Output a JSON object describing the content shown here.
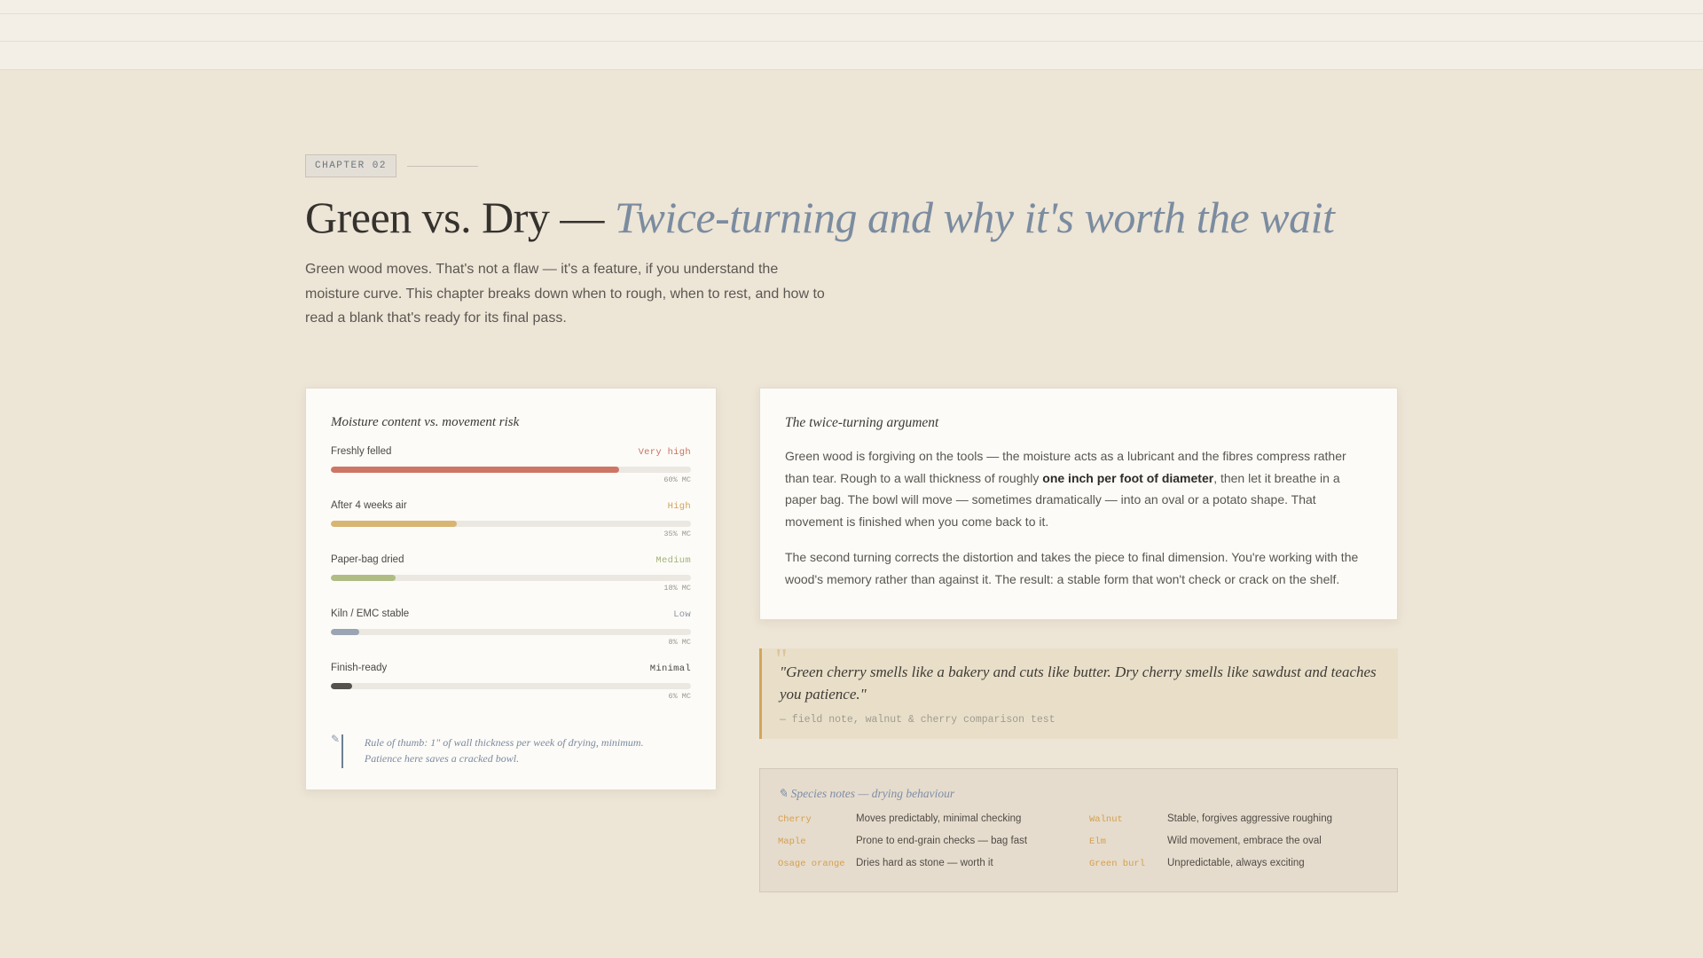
{
  "chapter": {
    "tag": "CHAPTER 02",
    "title_main": "Green vs. Dry — ",
    "title_accent": "Twice-turning and why it's worth the wait",
    "intro": "Green wood moves. That's not a flaw — it's a feature, if you understand the moisture curve. This chapter breaks down when to rough, when to rest, and how to read a blank that's ready for its final pass."
  },
  "moisture_card": {
    "heading": "Moisture content vs. movement risk",
    "stages": [
      {
        "label": "Freshly felled",
        "risk": "Very high",
        "mc": "60% MC",
        "level": 0.8,
        "color": "#cd7666"
      },
      {
        "label": "After 4 weeks air",
        "risk": "High",
        "mc": "35% MC",
        "level": 0.35,
        "color": "#d8b572"
      },
      {
        "label": "Paper-bag dried",
        "risk": "Medium",
        "mc": "18% MC",
        "level": 0.18,
        "color": "#b0bc84"
      },
      {
        "label": "Kiln / EMC stable",
        "risk": "Low",
        "mc": "8% MC",
        "level": 0.08,
        "color": "#9aa4b2"
      },
      {
        "label": "Finish-ready",
        "risk": "Minimal",
        "mc": "6% MC",
        "level": 0.06,
        "color": "#55524d"
      }
    ],
    "risk_colors": [
      "#c77362",
      "#d2a35a",
      "#a5b27a",
      "#8c96a4",
      "#4a4742"
    ],
    "rule_of_thumb": "Rule of thumb: 1\" of wall thickness per week of drying, minimum. Patience here saves a cracked bowl."
  },
  "argument": {
    "heading": "The twice-turning argument",
    "p1_before": "Green wood is forgiving on the tools — the moisture acts as a lubricant and the fibres compress rather than tear. Rough to a wall thickness of roughly ",
    "p1_bold": "one inch per foot of diameter",
    "p1_after": ", then let it breathe in a paper bag. The bowl will move — sometimes dramatically — into an oval or a potato shape. That movement is finished when you come back to it.",
    "p2": "The second turning corrects the distortion and takes the piece to final dimension. You're working with the wood's memory rather than against it. The result: a stable form that won't check or crack on the shelf."
  },
  "quote": {
    "mark": "\"",
    "text": "\"Green cherry smells like a bakery and cuts like butter. Dry cherry smells like sawdust and teaches you patience.\"",
    "source": "— field note, walnut & cherry comparison test"
  },
  "species": {
    "heading": "✎ Species notes — drying behaviour",
    "items": [
      {
        "name": "Cherry",
        "note": "Moves predictably, minimal checking"
      },
      {
        "name": "Walnut",
        "note": "Stable, forgives aggressive roughing"
      },
      {
        "name": "Maple",
        "note": "Prone to end-grain checks — bag fast"
      },
      {
        "name": "Elm",
        "note": "Wild movement, embrace the oval"
      },
      {
        "name": "Osage orange",
        "note": "Dries hard as stone — worth it"
      },
      {
        "name": "Green burl",
        "note": "Unpredictable, always exciting"
      }
    ]
  },
  "colors": {
    "background": "#ede5d6",
    "accent_blue": "#7b8ca0",
    "accent_gold": "#d4a55a"
  }
}
